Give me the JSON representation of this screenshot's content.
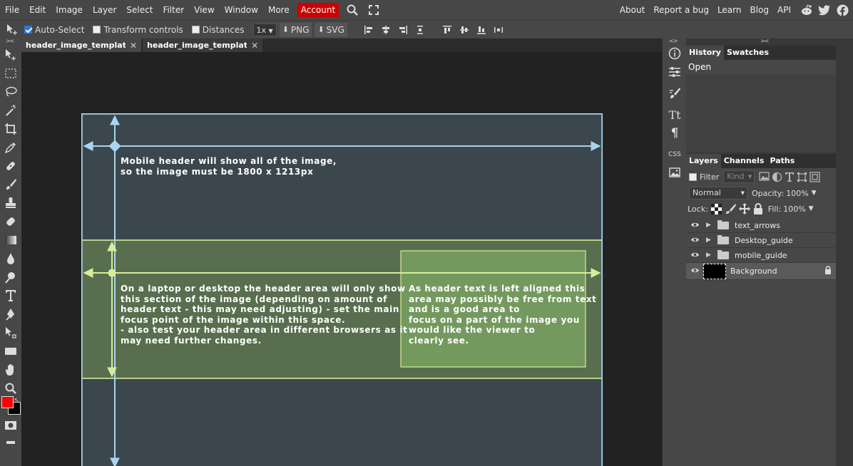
{
  "menu": {
    "items": [
      "File",
      "Edit",
      "Image",
      "Layer",
      "Select",
      "Filter",
      "View",
      "Window",
      "More"
    ],
    "account": "Account",
    "right_links": [
      "About",
      "Report a bug",
      "Learn",
      "Blog",
      "API"
    ]
  },
  "options": {
    "auto_select": "Auto-Select",
    "transform_controls": "Transform controls",
    "distances": "Distances",
    "zoom": "1x",
    "png": "PNG",
    "svg": "SVG"
  },
  "tabs": [
    {
      "label": "header_image_template.ps"
    },
    {
      "label": "header_image_template.ps"
    }
  ],
  "canvas": {
    "text_mobile": "Mobile header will show all of the image,\nso the image must be 1800 x 1213px",
    "text_desktop": "On a laptop or desktop the header area will only show\nthis section of the image (depending on amount of\nheader text - this may need adjusting) - set the main\nfocus point of the image within this space.\n- also test your header area in different browsers as it\nmay need further changes.",
    "text_left_aligned": "As header text is left aligned this\narea may possibly be free from text\nand is a good area to\nfocus on a part of the image you\nwould like the viewer to\nclearly see.",
    "colors": {
      "mobile_guide": "#a9d5f0",
      "desktop_guide": "#d9ec9c",
      "background": "#3b474c"
    }
  },
  "side_icons": {
    "type": "Tt",
    "paragraph": "¶",
    "css": "CSS"
  },
  "history_panel": {
    "tabs": [
      "History",
      "Swatches"
    ],
    "items": [
      "Open"
    ]
  },
  "layers_panel": {
    "tabs": [
      "Layers",
      "Channels",
      "Paths"
    ],
    "filter_label": "Filter",
    "kind_label": "Kind",
    "blend_mode": "Normal",
    "opacity_label": "Opacity:",
    "opacity_value": "100%",
    "lock_label": "Lock:",
    "fill_label": "Fill:",
    "fill_value": "100%",
    "layers": [
      {
        "name": "text_arrows"
      },
      {
        "name": "Desktop_guide"
      },
      {
        "name": "mobile_guide"
      },
      {
        "name": "Background"
      }
    ]
  },
  "colors": {
    "foreground": "#ff0000",
    "background": "#000000",
    "account_button": "#cc0000"
  }
}
